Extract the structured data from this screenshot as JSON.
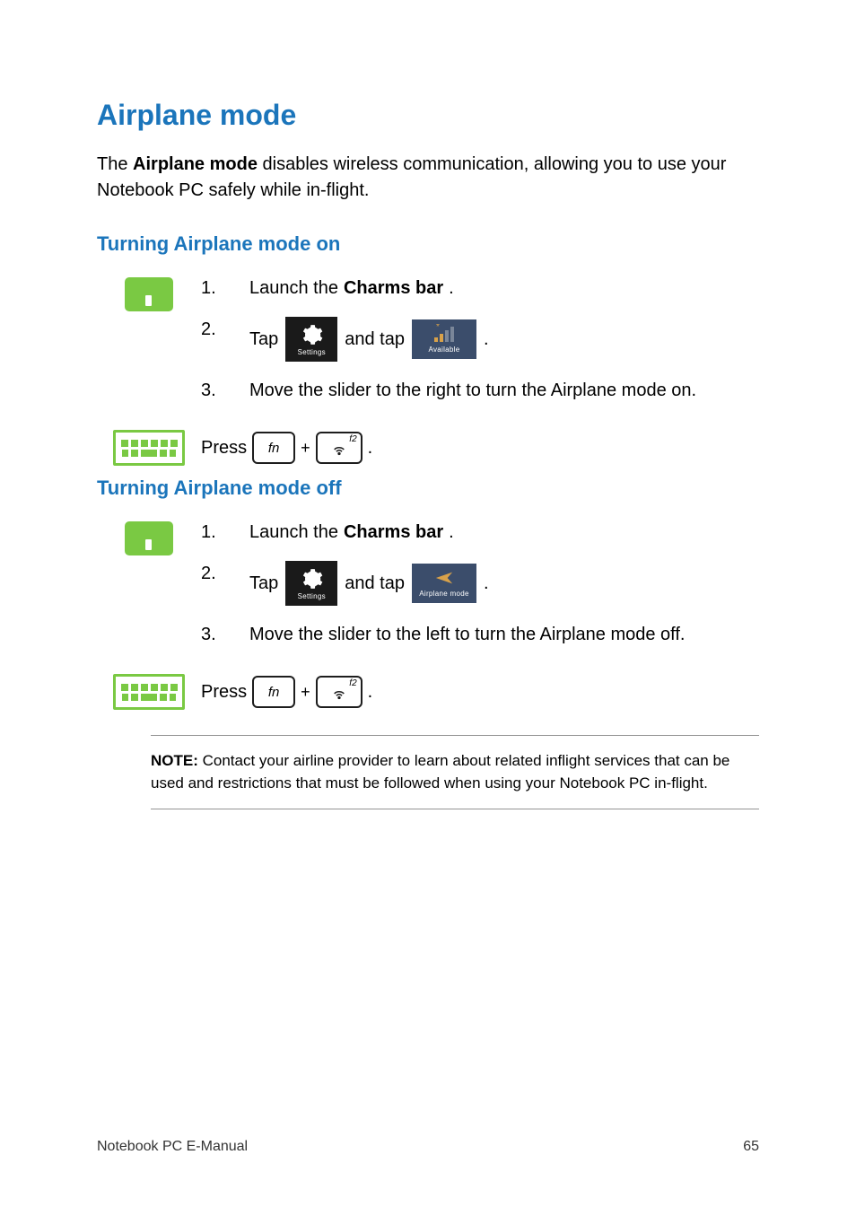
{
  "title": "Airplane mode",
  "intro": {
    "pre": "The ",
    "bold": "Airplane mode",
    "post": " disables wireless communication, allowing you to use your Notebook PC safely while in-flight."
  },
  "section_on": {
    "heading": "Turning Airplane mode on",
    "step1": {
      "num": "1.",
      "pre": "Launch the ",
      "bold": "Charms bar",
      "post": "."
    },
    "step2": {
      "num": "2.",
      "tap": "Tap",
      "and_tap": "and tap",
      "period": "."
    },
    "step3": {
      "num": "3.",
      "text": "Move the slider to the right to turn the Airplane mode on."
    },
    "press": "Press",
    "period": "."
  },
  "section_off": {
    "heading": "Turning Airplane mode off",
    "step1": {
      "num": "1.",
      "pre": "Launch the ",
      "bold": "Charms bar",
      "post": "."
    },
    "step2": {
      "num": "2.",
      "tap": "Tap",
      "and_tap": "and tap",
      "period": "."
    },
    "step3": {
      "num": "3.",
      "text": " Move the slider to the left to turn the Airplane mode off."
    },
    "press": "Press",
    "period": "."
  },
  "tiles": {
    "settings_label": "Settings",
    "available_label": "Available",
    "airplane_label": "Airplane mode"
  },
  "keys": {
    "fn": "fn",
    "f2": "f2",
    "plus": "+"
  },
  "note": {
    "label": "NOTE:",
    "text": " Contact your airline provider to learn about related inflight services that can be used and restrictions that must be followed when using your Notebook PC in-flight."
  },
  "footer": {
    "left": "Notebook PC E-Manual",
    "right": "65"
  }
}
